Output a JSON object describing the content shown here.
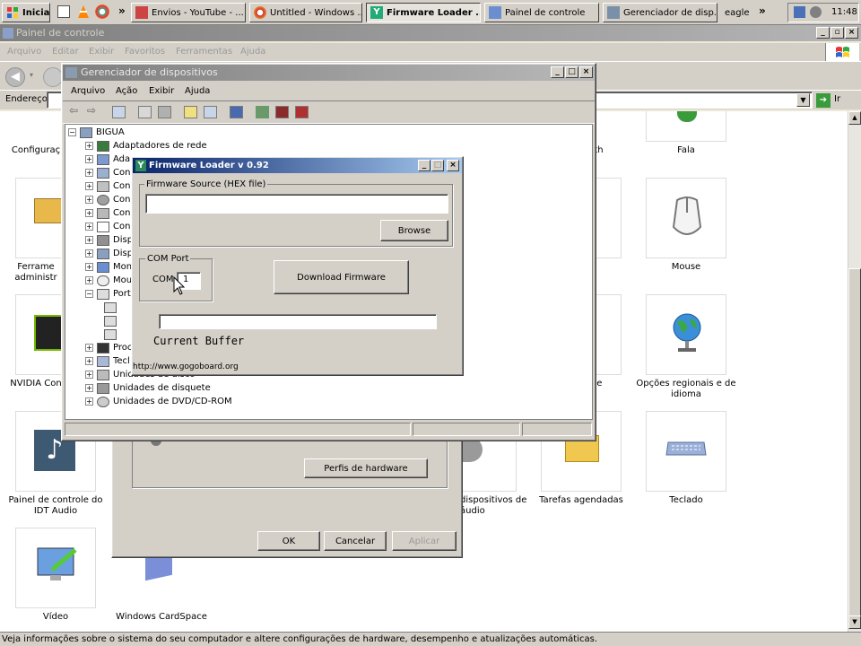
{
  "taskbar": {
    "start_label": "Iniciar",
    "tasks": [
      {
        "label": "Envios - YouTube - ..."
      },
      {
        "label": "Untitled - Windows ..."
      },
      {
        "label": "Firmware Loader ..."
      },
      {
        "label": "Painel de controle"
      },
      {
        "label": "Gerenciador de disp..."
      },
      {
        "label": "eagle"
      }
    ],
    "overflow": "»",
    "clock": "11:48"
  },
  "control_panel": {
    "title": "Painel de controle",
    "menu": [
      "Arquivo",
      "Editar",
      "Exibir",
      "Favoritos",
      "Ferramentas",
      "Ajuda"
    ],
    "address_label": "Endereço",
    "go_label": "Ir",
    "items": [
      {
        "label": "Configuraç",
        "icon": "config-icon"
      },
      {
        "label": "etooth",
        "icon": "bluetooth-icon"
      },
      {
        "label": "Fala",
        "icon": "speech-icon"
      },
      {
        "label": "Ferrame administr",
        "icon": "admin-tools-icon"
      },
      {
        "label": "Mouse",
        "icon": "mouse-icon"
      },
      {
        "label": "NVIDIA Con",
        "icon": "nvidia-icon"
      },
      {
        "label": "fone e",
        "icon": "phone-modem-icon"
      },
      {
        "label": "Opções regionais e de idioma",
        "icon": "globe-icon"
      },
      {
        "label": "Painel de controle do IDT Audio",
        "icon": "audio-note-icon"
      },
      {
        "label": "dispositivos de áudio",
        "icon": "speaker-icon"
      },
      {
        "label": "Tarefas agendadas",
        "icon": "scheduled-tasks-icon"
      },
      {
        "label": "Teclado",
        "icon": "keyboard-icon"
      },
      {
        "label": "Vídeo",
        "icon": "video-icon"
      },
      {
        "label": "Windows CardSpace",
        "icon": "cardspace-icon"
      }
    ],
    "status": "Veja informações sobre o sistema do seu computador e altere configurações de hardware, desempenho e atualizações automáticas."
  },
  "device_manager": {
    "title": "Gerenciador de dispositivos",
    "menu": [
      "Arquivo",
      "Ação",
      "Exibir",
      "Ajuda"
    ],
    "root": "BIGUA",
    "tree": [
      {
        "label": "Adaptadores de rede",
        "expander": "+"
      },
      {
        "label": "Ada",
        "expander": "+"
      },
      {
        "label": "Con",
        "expander": "+"
      },
      {
        "label": "Con",
        "expander": "+"
      },
      {
        "label": "Con",
        "expander": "+"
      },
      {
        "label": "Con",
        "expander": "+"
      },
      {
        "label": "Con",
        "expander": "+"
      },
      {
        "label": "Disp",
        "expander": "+"
      },
      {
        "label": "Disp",
        "expander": "+"
      },
      {
        "label": "Mon",
        "expander": "+"
      },
      {
        "label": "Mou",
        "expander": "+"
      },
      {
        "label": "Port",
        "expander": "−"
      },
      {
        "label": "",
        "expander": ""
      },
      {
        "label": "",
        "expander": ""
      },
      {
        "label": "",
        "expander": ""
      },
      {
        "label": "Proc",
        "expander": "+"
      },
      {
        "label": "Tecl",
        "expander": "+"
      },
      {
        "label": "Unidades de disco",
        "expander": "+"
      },
      {
        "label": "Unidades de disquete",
        "expander": "+"
      },
      {
        "label": "Unidades de DVD/CD-ROM",
        "expander": "+"
      }
    ]
  },
  "system_properties": {
    "hardware_profiles_label": "Perfis de hardware",
    "ok_label": "OK",
    "cancel_label": "Cancelar",
    "apply_label": "Aplicar"
  },
  "firmware_loader": {
    "title": "Firmware Loader v 0.92",
    "source_group_label": "Firmware Source (HEX file)",
    "source_path": "",
    "browse_label": "Browse",
    "com_group_label": "COM Port",
    "com_prefix": "COM",
    "com_value": "1",
    "download_label": "Download Firmware",
    "progress": 0,
    "buffer_label": "Current Buffer",
    "url": "http://www.gogoboard.org"
  }
}
